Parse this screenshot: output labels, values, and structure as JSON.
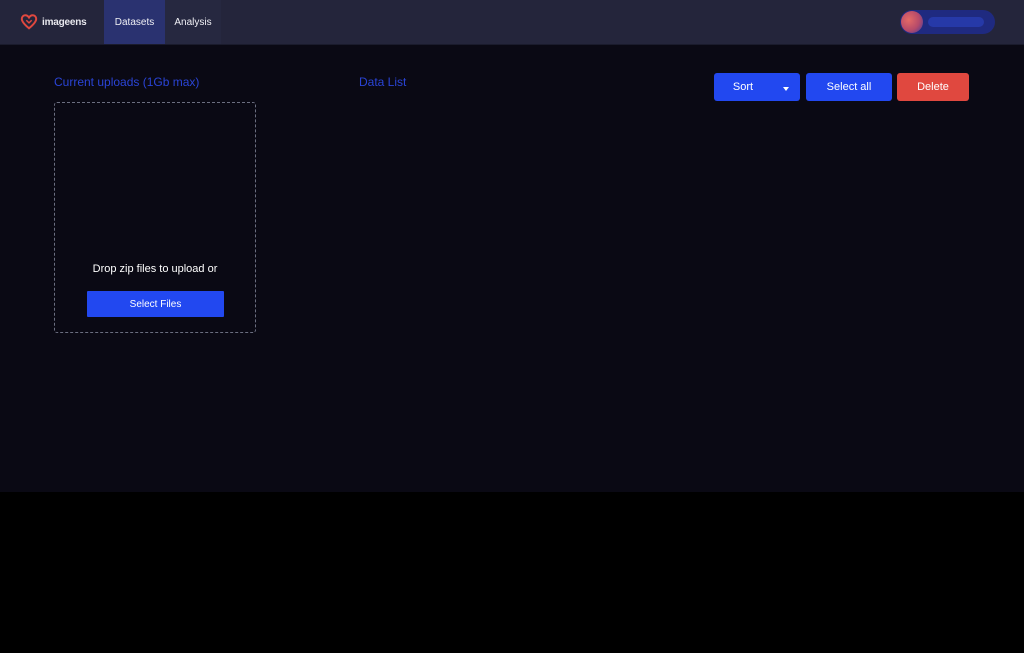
{
  "brand": {
    "name": "imageens",
    "logo_icon": "heart-logo-icon",
    "logo_color": "#e0483f"
  },
  "nav": {
    "tabs": [
      {
        "label": "Datasets",
        "active": true
      },
      {
        "label": "Analysis",
        "active": false
      }
    ]
  },
  "user": {
    "avatar_icon": "avatar-icon"
  },
  "uploads": {
    "title": "Current uploads (1Gb max)",
    "drop_text": "Drop zip files to upload or",
    "select_files_label": "Select Files"
  },
  "data_list": {
    "title": "Data List"
  },
  "toolbar": {
    "sort_label": "Sort",
    "sort_dropdown_icon": "caret-down-icon",
    "select_all_label": "Select all",
    "delete_label": "Delete"
  },
  "colors": {
    "accent": "#2248f0",
    "danger": "#e0483f",
    "navbar": "#24253b",
    "background": "#0a0914"
  }
}
